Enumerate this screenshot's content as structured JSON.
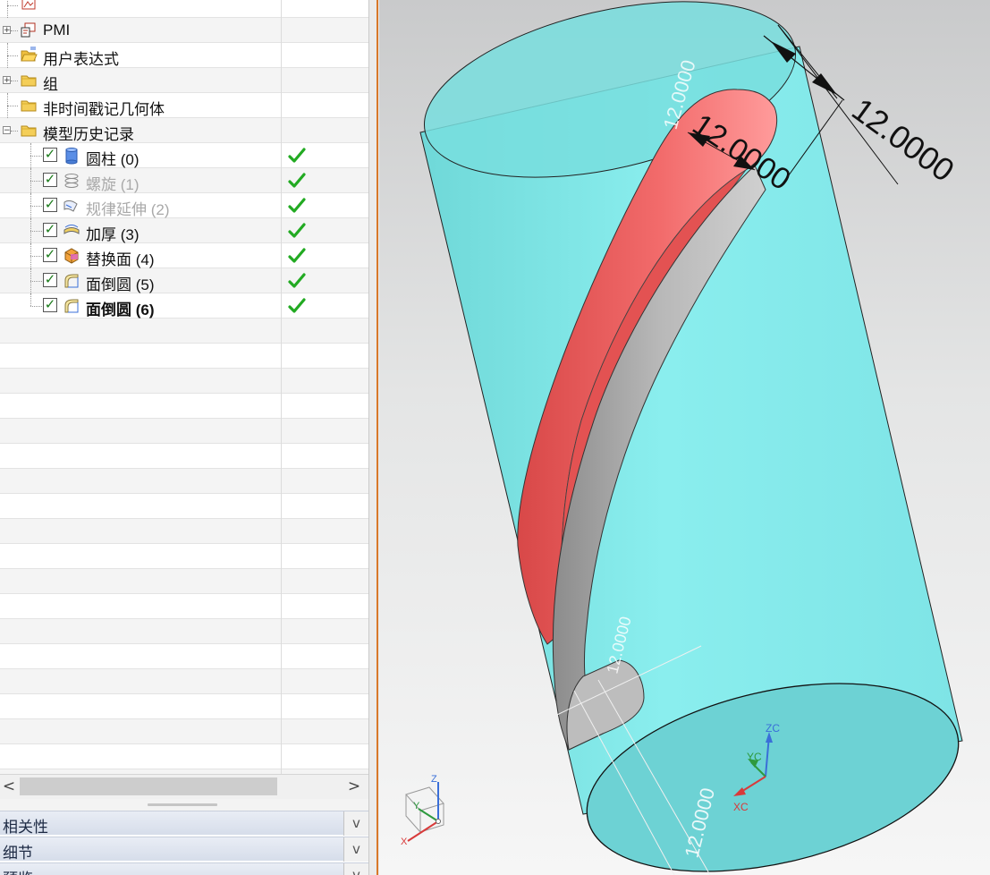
{
  "navigator": {
    "rows": [
      {
        "label": "",
        "icon": "drawing-icon"
      },
      {
        "label": "PMI",
        "icon": "pmi-icon"
      },
      {
        "label": "用户表达式",
        "icon": "open-folder-icon"
      },
      {
        "label": "组",
        "icon": "folder-icon"
      },
      {
        "label": "非时间戳记几何体",
        "icon": "folder-icon"
      },
      {
        "label": "模型历史记录",
        "icon": "folder-icon"
      }
    ],
    "features": [
      {
        "label": "圆柱 (0)",
        "icon": "cylinder-icon",
        "checked": true,
        "state": "normal"
      },
      {
        "label": "螺旋 (1)",
        "icon": "helix-icon",
        "checked": true,
        "state": "dimmed"
      },
      {
        "label": "规律延伸 (2)",
        "icon": "law-extension-icon",
        "checked": true,
        "state": "dimmed"
      },
      {
        "label": "加厚 (3)",
        "icon": "thicken-icon",
        "checked": true,
        "state": "normal"
      },
      {
        "label": "替换面 (4)",
        "icon": "replace-face-icon",
        "checked": true,
        "state": "normal"
      },
      {
        "label": "面倒圆 (5)",
        "icon": "face-blend-icon",
        "checked": true,
        "state": "normal"
      },
      {
        "label": "面倒圆 (6)",
        "icon": "face-blend-icon",
        "checked": true,
        "state": "current"
      }
    ],
    "scroll_left": "<",
    "scroll_right": ">"
  },
  "panels": [
    {
      "title": "相关性",
      "button": "v"
    },
    {
      "title": "细节",
      "button": "v"
    },
    {
      "title": "预览",
      "button": "v"
    }
  ],
  "viewport": {
    "dimension_labels": [
      "12.0000",
      "12.0000",
      "12.0000",
      "12.0000",
      "12.0000"
    ],
    "triad": {
      "x": "XC",
      "y": "YC",
      "z": "ZC"
    },
    "view_triad": {
      "x": "X",
      "y": "Y",
      "z": "Z"
    }
  },
  "colors": {
    "cylinder": "#7fe6e6",
    "helix_face": "#ef6262",
    "thicken_face": "#a9a9a9",
    "check_green": "#22aa22",
    "panel_edge": "#d8782a"
  }
}
